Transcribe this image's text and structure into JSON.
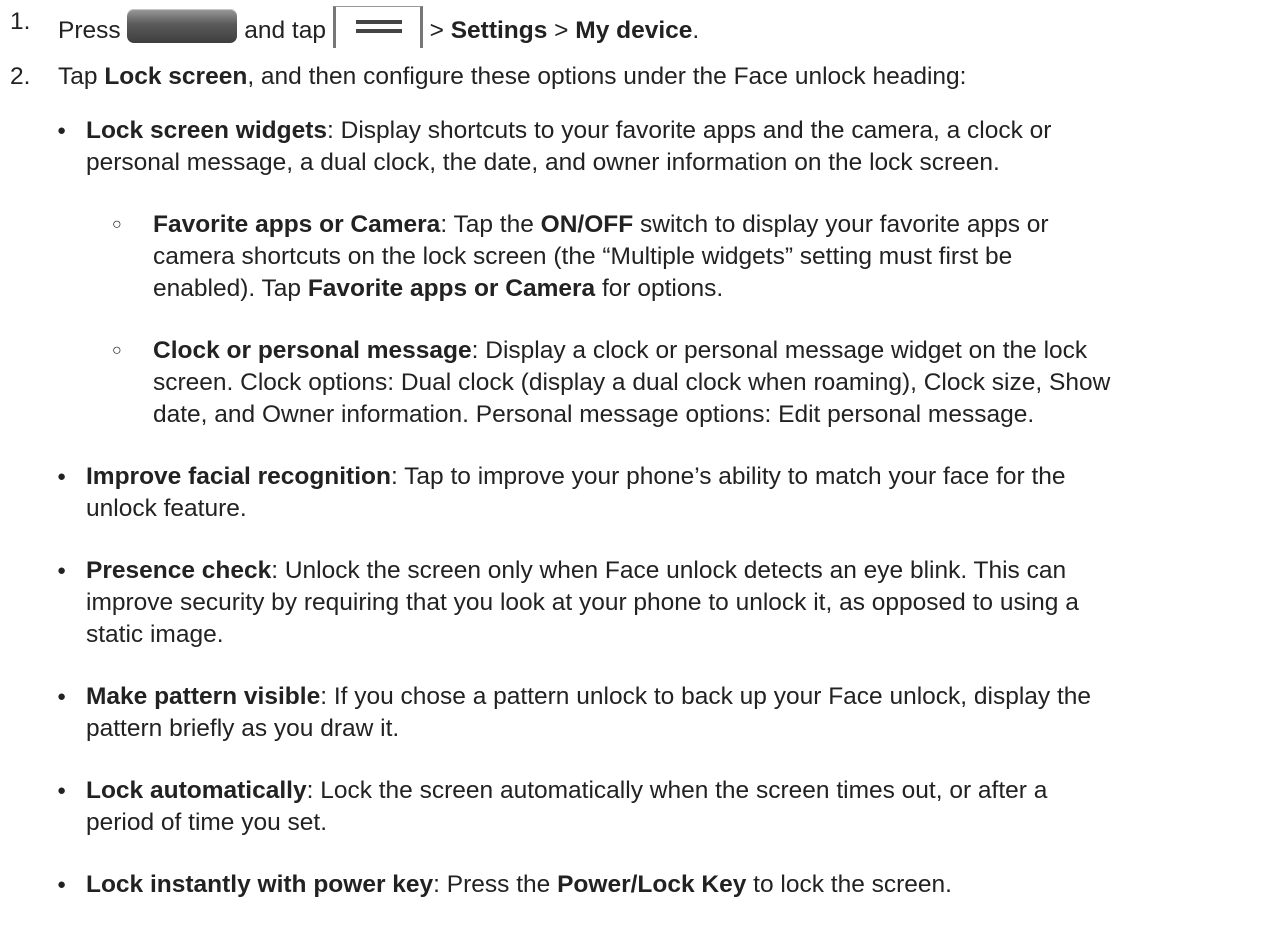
{
  "step1": {
    "number": "1.",
    "press": "Press ",
    "and_tap": " and tap ",
    "sep1": " > ",
    "settings": "Settings",
    "sep2": " > ",
    "my_device": "My device",
    "end": "."
  },
  "step2": {
    "number": "2.",
    "tap": "Tap ",
    "lock_screen": "Lock screen",
    "rest": ", and then configure these options under the Face unlock heading:"
  },
  "items": {
    "lock_widgets": {
      "title": "Lock screen widgets",
      "l1": ": Display shortcuts to your favorite apps and the camera, a clock or",
      "l2": "personal message, a dual clock, the date, and owner information on the lock screen."
    },
    "favorite_apps": {
      "title": "Favorite apps or Camera",
      "l1a": ": Tap the ",
      "onoff": "ON/OFF",
      "l1b": " switch to display your favorite apps or",
      "l2": "camera shortcuts on the lock screen (the “Multiple widgets” setting must first be",
      "l3a": "enabled). Tap ",
      "l3b": "Favorite apps or Camera",
      "l3c": " for options."
    },
    "clock_msg": {
      "title": "Clock or personal message",
      "l1": ": Display a clock or personal message widget on the lock",
      "l2": "screen. Clock options: Dual clock (display a dual clock when roaming), Clock size, Show",
      "l3": "date, and Owner information. Personal message options: Edit personal message."
    },
    "facial": {
      "title": "Improve facial recognition",
      "l1": ": Tap to improve your phone’s ability to match your face for the",
      "l2": "unlock feature."
    },
    "presence": {
      "title": "Presence check",
      "l1": ": Unlock the screen only when Face unlock detects an eye blink. This can",
      "l2": "improve security by requiring that you look at your phone to unlock it, as opposed to using a",
      "l3": "static image."
    },
    "pattern": {
      "title": "Make pattern visible",
      "l1": ": If you chose a pattern unlock to back up your Face unlock, display the",
      "l2": "pattern briefly as you draw it."
    },
    "auto": {
      "title": "Lock automatically",
      "l1": ": Lock the screen automatically when the screen times out, or after a",
      "l2": "period of time you set."
    },
    "instant": {
      "title": "Lock instantly with power key",
      "l1a": ": Press the ",
      "key": "Power/Lock Key",
      "l1b": " to lock the screen."
    }
  },
  "icons": {
    "home_button": "home-button-icon",
    "menu": "menu-icon"
  }
}
